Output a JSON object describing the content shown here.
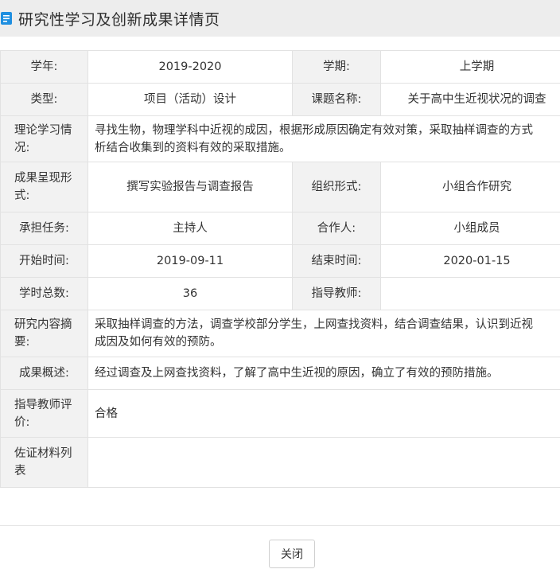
{
  "header": {
    "title": "研究性学习及创新成果详情页",
    "icon": "document-icon",
    "icon_color": "#1f8fe0"
  },
  "detail": {
    "year_label": "学年:",
    "year_value": "2019-2020",
    "term_label": "学期:",
    "term_value": "上学期",
    "type_label": "类型:",
    "type_value": "项目（活动）设计",
    "topic_label": "课题名称:",
    "topic_value": "关于高中生近视状况的调查",
    "theory_label": "理论学习情况:",
    "theory_line1": "寻找生物，物理学科中近视的成因，根据形成原因确定有效对策，采取抽样调查的方式",
    "theory_line2": "析结合收集到的资料有效的采取措施。",
    "result_form_label": "成果呈现形式:",
    "result_form_value": "撰写实验报告与调查报告",
    "org_label": "组织形式:",
    "org_value": "小组合作研究",
    "task_label": "承担任务:",
    "task_value": "主持人",
    "partner_label": "合作人:",
    "partner_value": "小组成员",
    "start_label": "开始时间:",
    "start_value": "2019-09-11",
    "end_label": "结束时间:",
    "end_value": "2020-01-15",
    "hours_label": "学时总数:",
    "hours_value": "36",
    "teacher_label": "指导教师:",
    "teacher_value": "",
    "abstract_label": "研究内容摘要:",
    "abstract_line1": "采取抽样调查的方法，调查学校部分学生，上网查找资料，结合调查结果，认识到近视",
    "abstract_line2": "成因及如何有效的预防。",
    "summary_label": "成果概述:",
    "summary_value": "经过调查及上网查找资料，了解了高中生近视的原因，确立了有效的预防措施。",
    "evaluation_label": "指导教师评价:",
    "evaluation_value": "合格",
    "evidence_label": "佐证材料列表",
    "evidence_value": ""
  },
  "footer": {
    "close_label": "关闭"
  }
}
